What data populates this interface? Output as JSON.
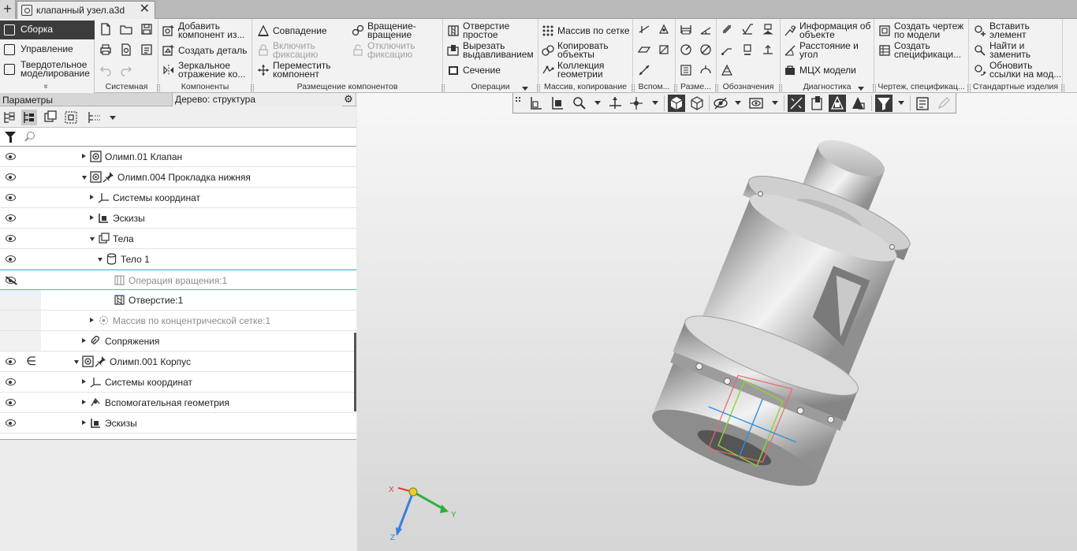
{
  "tabs": {
    "add": "+",
    "document_title": "клапанный узел.a3d",
    "close": "✕"
  },
  "modes": [
    {
      "label": "Сборка",
      "icon": "assembly-icon"
    },
    {
      "label": "Управление",
      "icon": "management-icon"
    },
    {
      "label_line1": "Твердотельное",
      "label_line2": "моделирование",
      "icon": "solid-modeling-icon"
    }
  ],
  "ribbon": {
    "collapse_glyph": "»",
    "groups": {
      "system": "Системная",
      "components": "Компоненты",
      "placement": "Размещение компонентов",
      "operations": "Операции",
      "array": "Массив, копирование",
      "aux": "Вспом...",
      "sizes": "Разме...",
      "designations": "Обозначения",
      "diagnostics": "Диагностика",
      "drawing": "Чертеж, спецификац...",
      "standard": "Стандартные изделия"
    },
    "components": {
      "add_component_1": "Добавить",
      "add_component_2": "компонент из...",
      "create_part": "Создать деталь",
      "mirror_1": "Зеркальное",
      "mirror_2": "отражение ко..."
    },
    "placement": {
      "coincidence": "Совпадение",
      "enable_fix_1": "Включить",
      "enable_fix_2": "фиксацию",
      "move_1": "Переместить",
      "move_2": "компонент",
      "rotation_1": "Вращение-",
      "rotation_2": "вращение",
      "disable_fix_1": "Отключить",
      "disable_fix_2": "фиксацию"
    },
    "operations": {
      "hole_1": "Отверстие",
      "hole_2": "простое",
      "cut_1": "Вырезать",
      "cut_2": "выдавливанием",
      "section": "Сечение"
    },
    "array": {
      "grid": "Массив по сетке",
      "copy_1": "Копировать",
      "copy_2": "объекты",
      "collection_1": "Коллекция",
      "collection_2": "геометрии"
    },
    "diagnostics": {
      "info_1": "Информация об",
      "info_2": "объекте",
      "distance_1": "Расстояние и",
      "distance_2": "угол",
      "mass": "МЦХ модели"
    },
    "drawing": {
      "create_drawing_1": "Создать чертеж",
      "create_drawing_2": "по модели",
      "create_spec_1": "Создать",
      "create_spec_2": "спецификаци..."
    },
    "standard": {
      "insert_1": "Вставить",
      "insert_2": "элемент",
      "find_1": "Найти и",
      "find_2": "заменить",
      "update_1": "Обновить",
      "update_2": "ссылки на мод..."
    }
  },
  "panel": {
    "parameters": "Параметры",
    "tree_title": "Дерево: структура",
    "search_placeholder": ""
  },
  "tree": [
    {
      "label": "Олимп.01 Клапан",
      "eye": "visible",
      "arrow": "right",
      "depth": 0,
      "icon": "part-icon",
      "dim": false
    },
    {
      "label": "Олимп.004 Прокладка нижняя",
      "eye": "visible",
      "arrow": "down",
      "depth": 0,
      "icon": "part-pinned-icon",
      "dim": false
    },
    {
      "label": "Системы координат",
      "eye": "visible",
      "arrow": "right",
      "depth": 1,
      "icon": "coordinate-systems-icon",
      "dim": false
    },
    {
      "label": "Эскизы",
      "eye": "visible",
      "arrow": "right",
      "depth": 1,
      "icon": "sketches-icon",
      "dim": false
    },
    {
      "label": "Тела",
      "eye": "visible",
      "arrow": "down",
      "depth": 1,
      "icon": "bodies-icon",
      "dim": false
    },
    {
      "label": "Тело 1",
      "eye": "visible",
      "arrow": "down",
      "depth": 2,
      "icon": "body-icon",
      "dim": false
    },
    {
      "label": "Операция вращения:1",
      "eye": "hidden",
      "arrow": "none",
      "depth": 3,
      "icon": "revolve-operation-icon",
      "dim": true
    },
    {
      "label": "Отверстие:1",
      "eye": "none",
      "arrow": "none",
      "depth": 3,
      "icon": "hole-operation-icon",
      "dim": false
    },
    {
      "label": "Массив по концентрической сетке:1",
      "eye": "none",
      "arrow": "right",
      "depth": 1,
      "icon": "concentric-array-icon",
      "dim": true
    },
    {
      "label": "Сопряжения",
      "eye": "none",
      "arrow": "right",
      "depth": 0,
      "icon": "mates-icon",
      "dim": false
    },
    {
      "label": "Олимп.001 Корпус",
      "eye": "visible",
      "arrow": "down",
      "depth": -1,
      "icon": "part-pinned-icon",
      "dim": false,
      "included": "∈"
    },
    {
      "label": "Системы координат",
      "eye": "visible",
      "arrow": "right",
      "depth": 0,
      "icon": "coordinate-systems-icon",
      "dim": false
    },
    {
      "label": "Вспомогательная геометрия",
      "eye": "visible",
      "arrow": "right",
      "depth": 0,
      "icon": "aux-geometry-icon",
      "dim": false
    },
    {
      "label": "Эскизы",
      "eye": "visible",
      "arrow": "right",
      "depth": 0,
      "icon": "sketches-icon",
      "dim": false
    }
  ],
  "triad": {
    "x": "X",
    "y": "Y",
    "z": "Z"
  },
  "colors": {
    "accent_dark": "#3c3c3c",
    "selection_line": "#46b9d8",
    "triad_x": "#e03a3a",
    "triad_y": "#2fae3a",
    "triad_z": "#3a7de0"
  }
}
